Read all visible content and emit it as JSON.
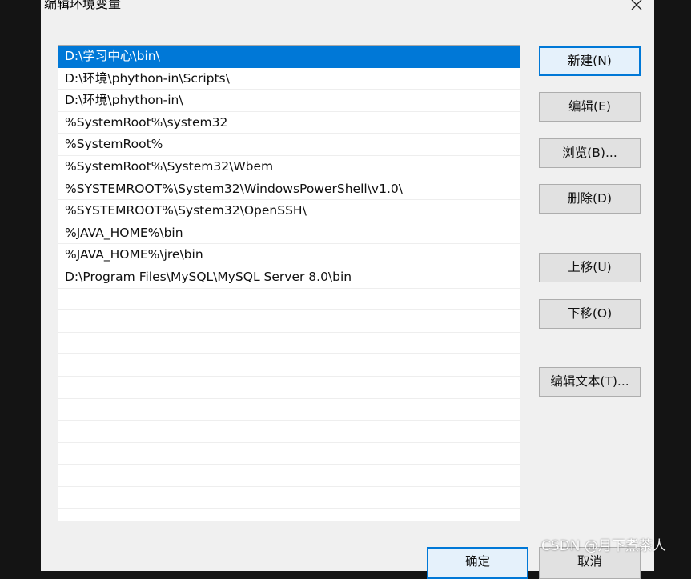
{
  "dialog": {
    "title": "编辑环境变量",
    "close_icon": "close-icon"
  },
  "paths": [
    "D:\\学习中心\\bin\\",
    "D:\\环境\\phython-in\\Scripts\\",
    "D:\\环境\\phython-in\\",
    "%SystemRoot%\\system32",
    "%SystemRoot%",
    "%SystemRoot%\\System32\\Wbem",
    "%SYSTEMROOT%\\System32\\WindowsPowerShell\\v1.0\\",
    "%SYSTEMROOT%\\System32\\OpenSSH\\",
    "%JAVA_HOME%\\bin",
    "%JAVA_HOME%\\jre\\bin",
    "D:\\Program Files\\MySQL\\MySQL Server 8.0\\bin"
  ],
  "selected_index": 0,
  "buttons": {
    "new": "新建(N)",
    "edit": "编辑(E)",
    "browse": "浏览(B)...",
    "delete": "删除(D)",
    "move_up": "上移(U)",
    "move_down": "下移(O)",
    "edit_text": "编辑文本(T)...",
    "ok": "确定",
    "cancel": "取消"
  },
  "watermark": "CSDN @月下煮茶人",
  "colors": {
    "selection": "#0078d7",
    "dialog_bg": "#f0f0f0",
    "outer_bg": "#141414"
  }
}
